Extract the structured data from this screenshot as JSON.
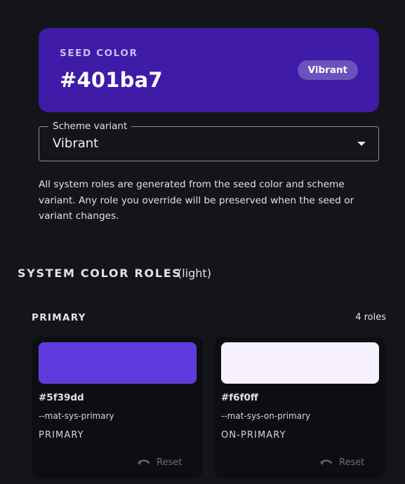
{
  "seed": {
    "label": "SEED COLOR",
    "hex": "#401ba7",
    "variant_chip": "Vibrant",
    "color": "#401ba7"
  },
  "scheme_field": {
    "legend": "Scheme variant",
    "value": "Vibrant"
  },
  "helper_text": "All system roles are generated from the seed color and scheme variant. Any role you override will be preserved when the seed or variant changes.",
  "roles_section": {
    "title": "SYSTEM COLOR ROLES",
    "mode": "(light)"
  },
  "group": {
    "title": "PRIMARY",
    "count": "4 roles"
  },
  "roles": [
    {
      "hex": "#5f39dd",
      "var": "--mat-sys-primary",
      "name": "PRIMARY",
      "swatch": "#5f39dd",
      "reset_label": "Reset"
    },
    {
      "hex": "#f6f0ff",
      "var": "--mat-sys-on-primary",
      "name": "ON-PRIMARY",
      "swatch": "#f6f0ff",
      "reset_label": "Reset"
    }
  ]
}
